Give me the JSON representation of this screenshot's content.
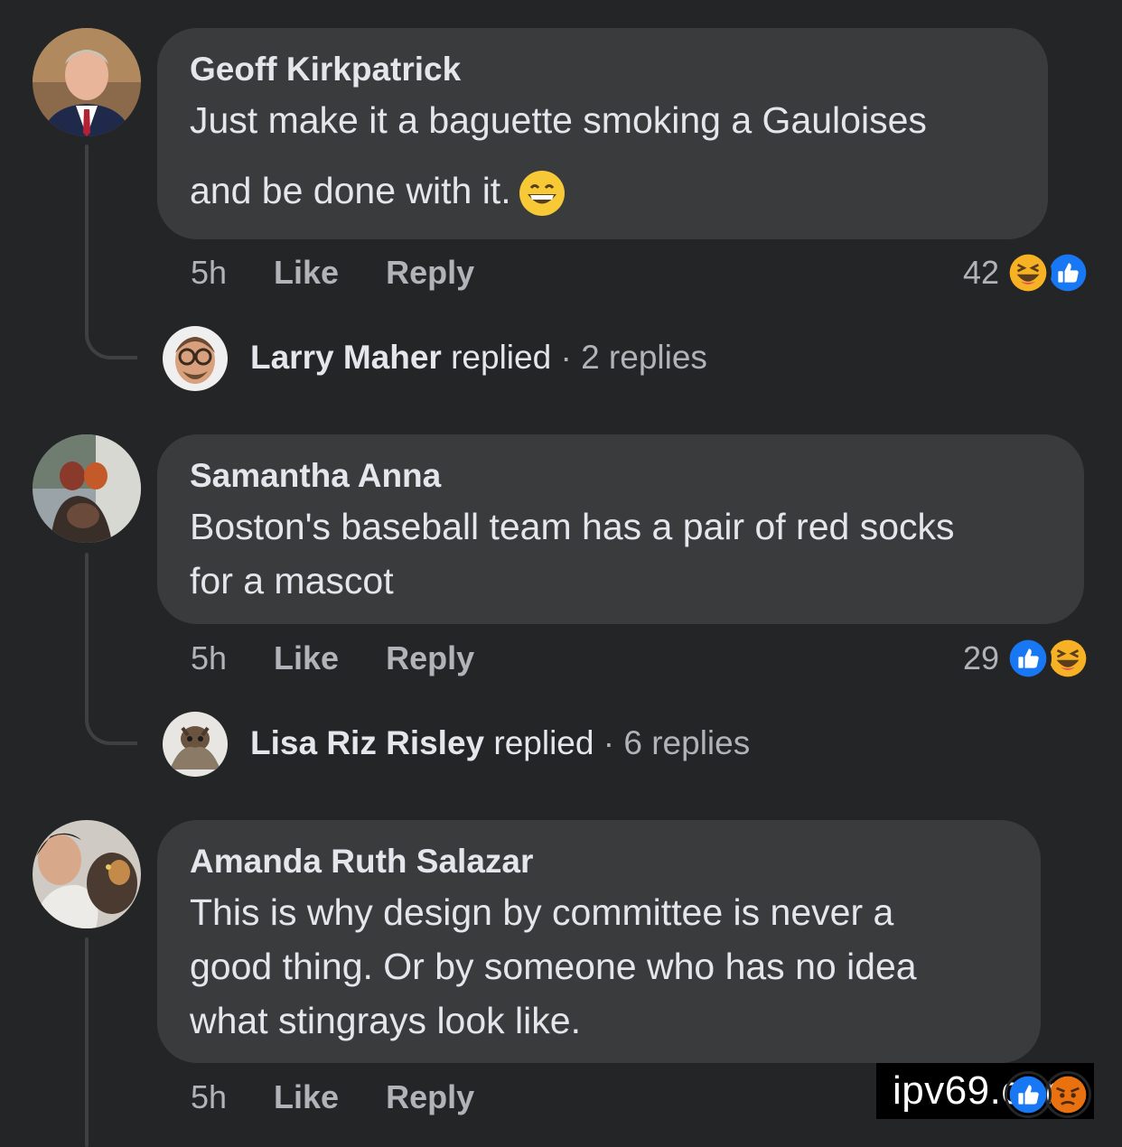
{
  "comments": [
    {
      "author": "Geoff Kirkpatrick",
      "text_line1": "Just make it a baguette smoking a Gauloises",
      "text_line2": "and be done with it.",
      "emoji": "grinning-face-icon",
      "time": "5h",
      "like_label": "Like",
      "reply_label": "Reply",
      "reaction_count": "42",
      "reactions": [
        "haha-reaction-icon",
        "like-reaction-icon"
      ],
      "replies": {
        "name": "Larry Maher",
        "verb": "replied",
        "separator": "·",
        "count_text": "2 replies"
      }
    },
    {
      "author": "Samantha Anna",
      "text_line1": "Boston's baseball team has a pair of red socks",
      "text_line2": "for a mascot",
      "time": "5h",
      "like_label": "Like",
      "reply_label": "Reply",
      "reaction_count": "29",
      "reactions": [
        "like-reaction-icon",
        "haha-reaction-icon"
      ],
      "replies": {
        "name": "Lisa Riz Risley",
        "verb": "replied",
        "separator": "·",
        "count_text": "6 replies"
      }
    },
    {
      "author": "Amanda Ruth Salazar",
      "text_line1": "This is why design by committee is never a",
      "text_line2": "good thing. Or by someone who has no idea",
      "text_line3": "what stingrays look like.",
      "time": "5h",
      "like_label": "Like",
      "reply_label": "Reply",
      "reactions": [
        "like-reaction-icon",
        "angry-reaction-icon"
      ]
    }
  ],
  "watermark": "ipv69.com",
  "colors": {
    "background": "#242526",
    "bubble": "#3a3b3c",
    "primary_text": "#e4e6eb",
    "secondary_text": "#b0b3b8",
    "like_blue": "#1877f2",
    "haha_yellow": "#f7b125"
  }
}
